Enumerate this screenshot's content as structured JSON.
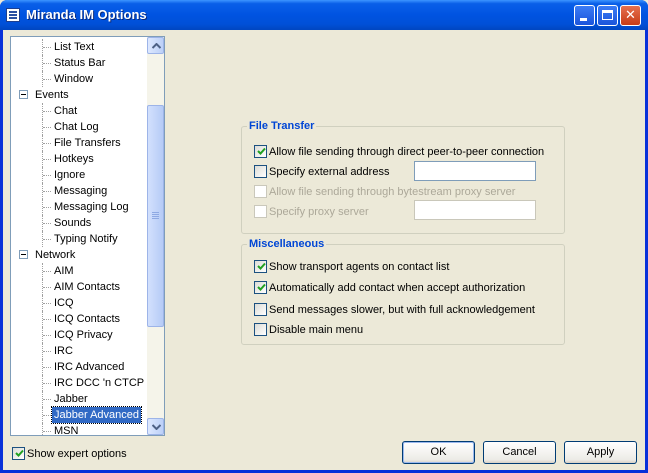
{
  "window": {
    "title": "Miranda IM Options",
    "buttons": [
      "minimize",
      "maximize",
      "close"
    ]
  },
  "tree": {
    "items": [
      {
        "label": "List Text",
        "level": 2
      },
      {
        "label": "Status Bar",
        "level": 2
      },
      {
        "label": "Window",
        "level": 2
      },
      {
        "label": "Events",
        "level": 1,
        "expanded": true
      },
      {
        "label": "Chat",
        "level": 2
      },
      {
        "label": "Chat Log",
        "level": 2
      },
      {
        "label": "File Transfers",
        "level": 2
      },
      {
        "label": "Hotkeys",
        "level": 2
      },
      {
        "label": "Ignore",
        "level": 2
      },
      {
        "label": "Messaging",
        "level": 2
      },
      {
        "label": "Messaging Log",
        "level": 2
      },
      {
        "label": "Sounds",
        "level": 2
      },
      {
        "label": "Typing Notify",
        "level": 2
      },
      {
        "label": "Network",
        "level": 1,
        "expanded": true
      },
      {
        "label": "AIM",
        "level": 2
      },
      {
        "label": "AIM Contacts",
        "level": 2
      },
      {
        "label": "ICQ",
        "level": 2
      },
      {
        "label": "ICQ Contacts",
        "level": 2
      },
      {
        "label": "ICQ Privacy",
        "level": 2
      },
      {
        "label": "IRC",
        "level": 2
      },
      {
        "label": "IRC Advanced",
        "level": 2
      },
      {
        "label": "IRC DCC 'n CTCP",
        "level": 2
      },
      {
        "label": "Jabber",
        "level": 2
      },
      {
        "label": "Jabber Advanced",
        "level": 2,
        "selected": true
      },
      {
        "label": "MSN",
        "level": 2
      }
    ]
  },
  "file_transfer": {
    "title": "File Transfer",
    "options": [
      {
        "label": "Allow file sending through direct peer-to-peer connection",
        "checked": true,
        "enabled": true
      },
      {
        "label": "Specify external address",
        "checked": false,
        "enabled": true,
        "field_value": ""
      },
      {
        "label": "Allow file sending through bytestream proxy server",
        "checked": false,
        "enabled": false
      },
      {
        "label": "Specify proxy server",
        "checked": false,
        "enabled": false,
        "field_value": ""
      }
    ]
  },
  "misc": {
    "title": "Miscellaneous",
    "options": [
      {
        "label": "Show transport agents on contact list",
        "checked": true
      },
      {
        "label": "Automatically add contact when accept authorization",
        "checked": true
      },
      {
        "label": "Send messages slower, but with full acknowledgement",
        "checked": false
      },
      {
        "label": "Disable main menu",
        "checked": false
      }
    ]
  },
  "footer": {
    "expert_label": "Show expert options",
    "expert_checked": true,
    "ok_label": "OK",
    "cancel_label": "Cancel",
    "apply_label": "Apply"
  },
  "colors": {
    "titlebar": "#0053E1",
    "group_title": "#0046D5",
    "selection": "#316AC5",
    "disabled_text": "#ACA899"
  }
}
